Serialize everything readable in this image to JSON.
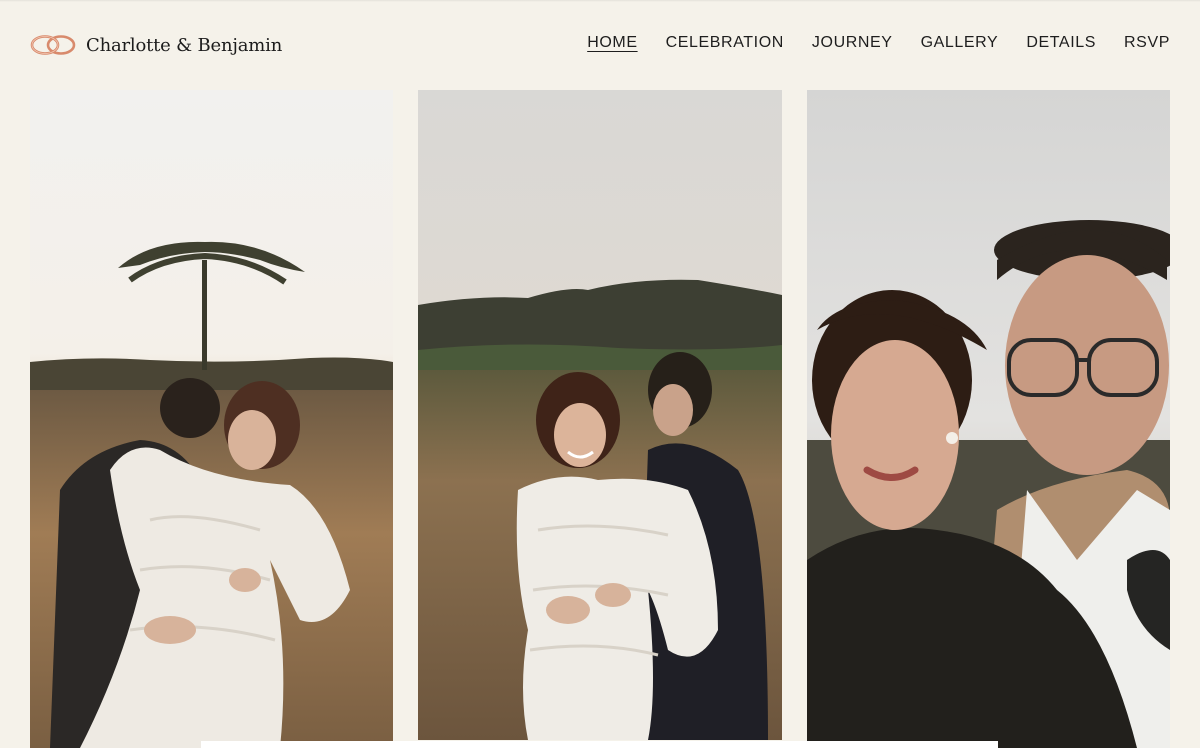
{
  "header": {
    "logo_icon": "interlocked-rings-icon",
    "site_name": "Charlotte & Benjamin",
    "accent_color": "#d88a6c"
  },
  "nav": {
    "items": [
      {
        "label": "HOME",
        "active": true
      },
      {
        "label": "CELEBRATION",
        "active": false
      },
      {
        "label": "JOURNEY",
        "active": false
      },
      {
        "label": "GALLERY",
        "active": false
      },
      {
        "label": "DETAILS",
        "active": false
      },
      {
        "label": "RSVP",
        "active": false
      }
    ]
  },
  "gallery": {
    "photos": [
      {
        "subject": "couple embracing in tall grass under a lone tree"
      },
      {
        "subject": "smiling couple in golden meadow with hills behind"
      },
      {
        "subject": "close-up portrait of the couple"
      }
    ]
  }
}
